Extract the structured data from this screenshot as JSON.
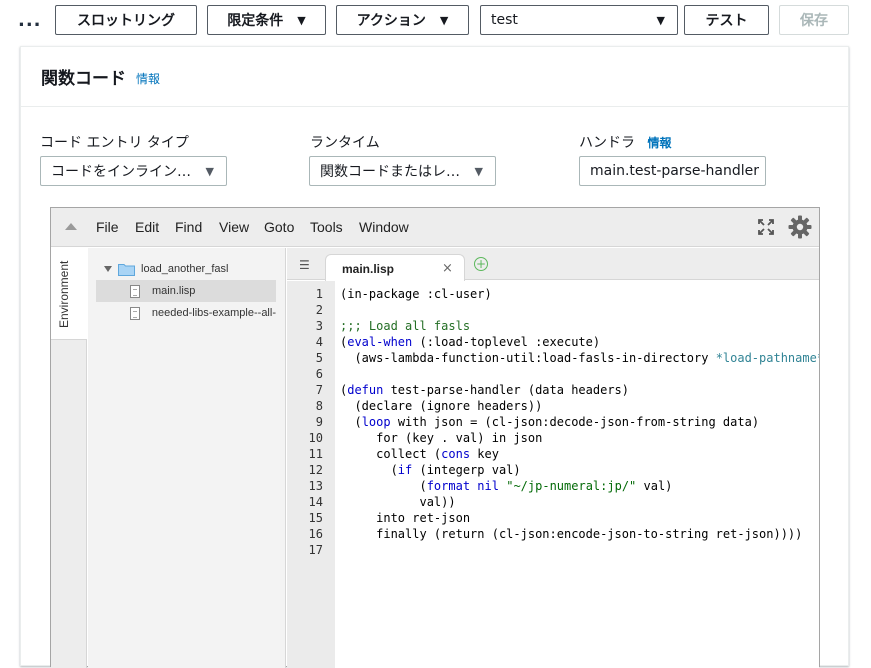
{
  "toolbar": {
    "more_dots": "...",
    "throttling_label": "スロットリング",
    "qualifiers_label": "限定条件",
    "actions_label": "アクション",
    "test_event_value": "test",
    "test_label": "テスト",
    "save_label": "保存"
  },
  "panel": {
    "title": "関数コード",
    "info": "情報",
    "code_entry_label": "コード エントリ タイプ",
    "code_entry_value": "コードをインライン…",
    "runtime_label": "ランタイム",
    "runtime_value": "関数コードまたはレ…",
    "handler_label": "ハンドラ",
    "handler_info": "情報",
    "handler_value": "main.test-parse-handler"
  },
  "editor": {
    "menu": [
      "File",
      "Edit",
      "Find",
      "View",
      "Goto",
      "Tools",
      "Window"
    ],
    "side_tab": "Environment",
    "tree": {
      "folder": "load_another_fasl",
      "files": [
        "main.lisp",
        "needed-libs-example--all-"
      ]
    },
    "tab_label": "main.lisp",
    "tab_close": "×",
    "tab_add": "+",
    "line_numbers": [
      "1",
      "2",
      "3",
      "4",
      "5",
      "6",
      "7",
      "8",
      "9",
      "10",
      "11",
      "12",
      "13",
      "14",
      "15",
      "16",
      "17"
    ]
  }
}
